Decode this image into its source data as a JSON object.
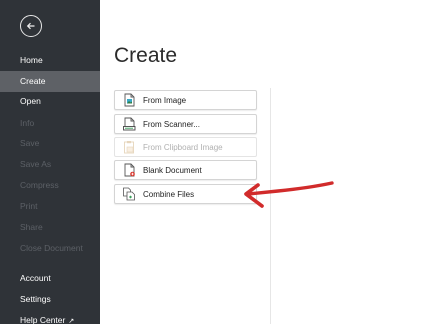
{
  "sidebar": {
    "back_icon": "back-arrow-icon",
    "items": [
      {
        "label": "Home"
      },
      {
        "label": "Create"
      },
      {
        "label": "Open"
      },
      {
        "label": "Info"
      },
      {
        "label": "Save"
      },
      {
        "label": "Save As"
      },
      {
        "label": "Compress"
      },
      {
        "label": "Print"
      },
      {
        "label": "Share"
      },
      {
        "label": "Close Document"
      },
      {
        "label": "Account"
      },
      {
        "label": "Settings"
      },
      {
        "label": "Help Center"
      }
    ],
    "active_item": "Create",
    "background": "#2f3338",
    "active_background": "#5e6166"
  },
  "main": {
    "title": "Create",
    "options": [
      {
        "label": "From Image",
        "icon": "image-document-icon"
      },
      {
        "label": "From Scanner...",
        "icon": "scanner-document-icon"
      },
      {
        "label": "From Clipboard Image",
        "icon": "clipboard-document-icon",
        "disabled": true
      },
      {
        "label": "Blank Document",
        "icon": "blank-document-icon"
      },
      {
        "label": "Combine Files",
        "icon": "combine-files-icon"
      }
    ]
  },
  "annotation": {
    "color": "#d12b2b"
  }
}
